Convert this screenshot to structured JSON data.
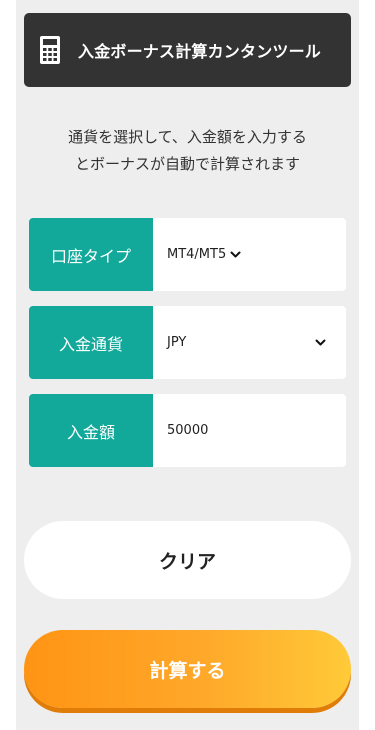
{
  "header": {
    "title": "入金ボーナス計算カンタンツール",
    "icon": "calculator-icon"
  },
  "intro": {
    "line1": "通貨を選択して、入金額を入力する",
    "line2": "とボーナスが自動で計算されます"
  },
  "form": {
    "account_type": {
      "label": "口座タイプ",
      "value": "MT4/MT5"
    },
    "currency": {
      "label": "入金通貨",
      "value": "JPY"
    },
    "amount": {
      "label": "入金額",
      "value": "50000"
    }
  },
  "buttons": {
    "clear_label": "クリア",
    "calculate_label": "計算する"
  },
  "colors": {
    "accent_teal": "#12a99b",
    "title_bg": "#333333",
    "cta_start": "#ff9414",
    "cta_end": "#ffca38"
  }
}
